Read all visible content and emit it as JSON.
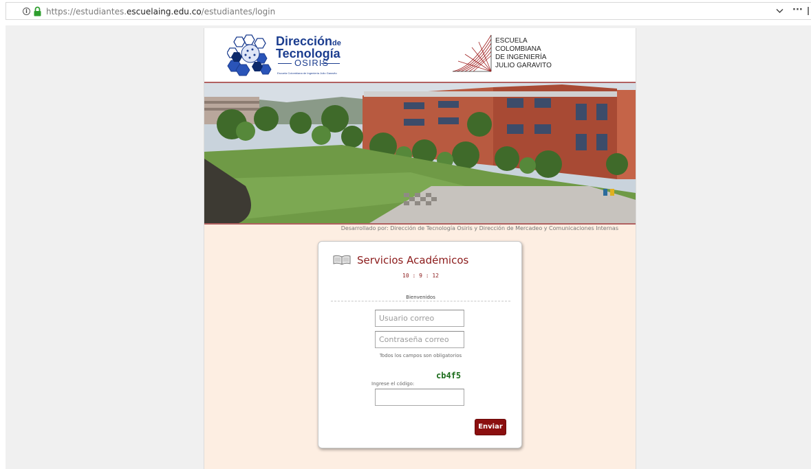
{
  "browser": {
    "url_prefix": "https://estudiantes.",
    "url_domain": "escuelaing.edu.co",
    "url_path": "/estudiantes/login",
    "more_label": "···"
  },
  "header": {
    "osiris_title_1": "Dirección",
    "osiris_title_1_suffix": "de",
    "osiris_title_2": "Tecnología",
    "osiris_word": "OSIRIS",
    "osiris_caption": "Escuela Colombiana de Ingeniería Julio Garavito",
    "eci_lines": [
      "ESCUELA",
      "COLOMBIANA",
      "DE INGENIERÍA",
      "JULIO GARAVITO"
    ]
  },
  "credit": "Desarrollado por: Dirección de Tecnología Osiris y Dirección de Mercadeo y Comunicaciones Internas",
  "login": {
    "title": "Servicios Académicos",
    "clock": "10 : 9 : 12",
    "welcome": "Bienvenidos",
    "username_placeholder": "Usuario correo",
    "password_placeholder": "Contraseña correo",
    "required_note": "Todos los campos son obligatorios",
    "code_label": "Ingrese el código:",
    "captcha": "cb4f5",
    "submit_label": "Enviar"
  },
  "colors": {
    "brand_red": "#8b1a1a",
    "osiris_blue": "#1b3d8f",
    "page_background": "#fdeee2",
    "captcha_green": "#1a6b1a"
  }
}
